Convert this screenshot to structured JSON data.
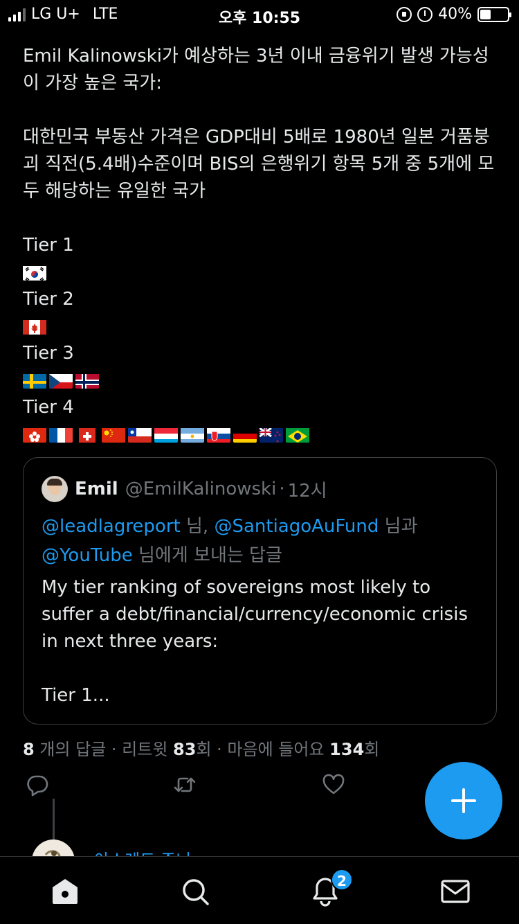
{
  "status_bar": {
    "carrier": "LG U+",
    "network": "LTE",
    "time": "오후 10:55",
    "battery": "40%",
    "battery_level": 0.4
  },
  "tweet": {
    "paragraph1": "Emil Kalinowski가 예상하는 3년 이내 금융위기 발생 가능성이 가장 높은 국가:",
    "paragraph2": "대한민국 부동산 가격은 GDP대비 5배로 1980년 일본 거품붕괴 직전(5.4배)수준이며 BIS의 은행위기 항목 5개 중 5개에 모두 해당하는 유일한 국가",
    "tiers": [
      {
        "label": "Tier 1",
        "flags": [
          "korea"
        ]
      },
      {
        "label": "Tier 2",
        "flags": [
          "canada"
        ]
      },
      {
        "label": "Tier 3",
        "flags": [
          "sweden",
          "czech",
          "norway"
        ]
      },
      {
        "label": "Tier 4",
        "flags": [
          "hong-kong",
          "france",
          "switzerland",
          "china",
          "chile",
          "luxembourg",
          "argentina",
          "slovakia",
          "germany",
          "new-zealand",
          "brazil"
        ]
      }
    ]
  },
  "quote": {
    "name": "Emil",
    "handle": "@EmilKalinowski",
    "separator": "·",
    "time": "12시",
    "mention1": "@leadlagreport",
    "reply_text1": " 님, ",
    "mention2": "@SantiagoAuFund",
    "reply_text2": " 님과",
    "mention3": "@YouTube",
    "reply_text3": " 님에게 보내는 답글",
    "body": "My tier ranking of sovereigns most likely to suffer a debt/financial/currency/economic crisis in next three years:",
    "body_tail": "Tier 1..."
  },
  "stats": {
    "replies": "8",
    "replies_label": " 개의 답글 · 리트윗 ",
    "retweets": "83",
    "retweets_label": "회 · 마음에 들어요 ",
    "likes": "134",
    "likes_label": "회"
  },
  "next_reply_name": "아스레드 주니",
  "tabbar": {
    "notifications_badge": "2"
  },
  "icons": {
    "reply": "reply-icon",
    "retweet": "retweet-icon",
    "like": "heart-icon",
    "compose": "plus-icon",
    "home": "home-icon",
    "search": "search-icon",
    "notifications": "bell-icon",
    "messages": "mail-icon"
  },
  "colors": {
    "accent": "#1d9bf0",
    "background": "#000000",
    "text": "#e7e9ea",
    "muted": "#71767b"
  }
}
